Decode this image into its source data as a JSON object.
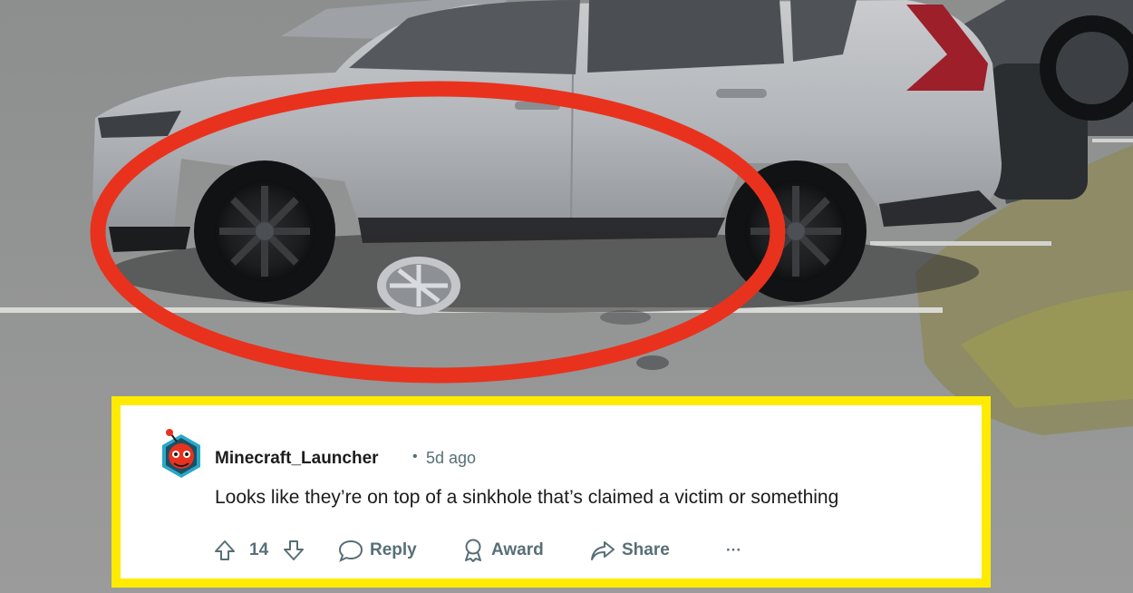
{
  "comment": {
    "username": "Minecraft_Launcher",
    "separator": "•",
    "age": "5d ago",
    "text": "Looks like they’re on top of a sinkhole that’s claimed a victim or something",
    "vote_count": "14",
    "reply_label": "Reply",
    "award_label": "Award",
    "share_label": "Share",
    "more_label": "···"
  },
  "icons": {
    "upvote": "arrow-up-icon",
    "downvote": "arrow-down-icon",
    "reply": "speech-bubble-icon",
    "award": "award-ribbon-icon",
    "share": "share-arrow-icon",
    "more": "ellipsis-icon"
  },
  "colors": {
    "highlight_ellipse": "#e8321e",
    "card_border": "#ffeb00",
    "muted_text": "#576f76",
    "primary_text": "#1c1c1c"
  }
}
